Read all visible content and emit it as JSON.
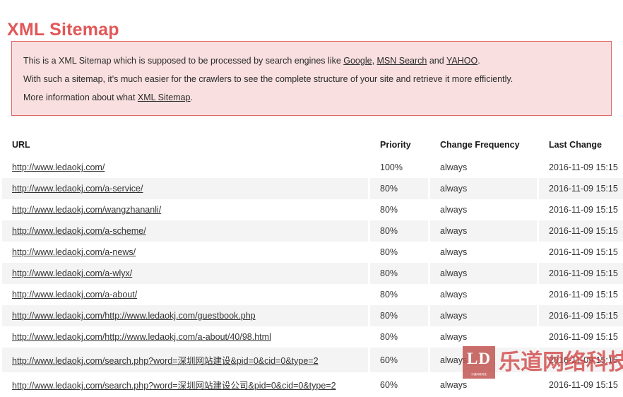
{
  "page": {
    "title": "XML Sitemap"
  },
  "info": {
    "line1_pre": "This is a XML Sitemap which is supposed to be processed by search engines like ",
    "link_google": "Google",
    "line1_sep1": ", ",
    "link_msn": "MSN Search",
    "line1_sep2": " and ",
    "link_yahoo": "YAHOO",
    "line1_end": ".",
    "line2": "With such a sitemap, it's much easier for the crawlers to see the complete structure of your site and retrieve it more efficiently.",
    "line3_pre": "More information about what ",
    "link_xml_sitemap": "XML Sitemap",
    "line3_end": "."
  },
  "table": {
    "headers": {
      "url": "URL",
      "priority": "Priority",
      "frequency": "Change Frequency",
      "lastchange": "Last Change"
    },
    "rows": [
      {
        "url": "http://www.ledaokj.com/",
        "priority": "100%",
        "frequency": "always",
        "lastchange": "2016-11-09 15:15"
      },
      {
        "url": "http://www.ledaokj.com/a-service/",
        "priority": "80%",
        "frequency": "always",
        "lastchange": "2016-11-09 15:15"
      },
      {
        "url": "http://www.ledaokj.com/wangzhananli/",
        "priority": "80%",
        "frequency": "always",
        "lastchange": "2016-11-09 15:15"
      },
      {
        "url": "http://www.ledaokj.com/a-scheme/",
        "priority": "80%",
        "frequency": "always",
        "lastchange": "2016-11-09 15:15"
      },
      {
        "url": "http://www.ledaokj.com/a-news/",
        "priority": "80%",
        "frequency": "always",
        "lastchange": "2016-11-09 15:15"
      },
      {
        "url": "http://www.ledaokj.com/a-wlyx/",
        "priority": "80%",
        "frequency": "always",
        "lastchange": "2016-11-09 15:15"
      },
      {
        "url": "http://www.ledaokj.com/a-about/",
        "priority": "80%",
        "frequency": "always",
        "lastchange": "2016-11-09 15:15"
      },
      {
        "url": "http://www.ledaokj.com/http://www.ledaokj.com/guestbook.php",
        "priority": "80%",
        "frequency": "always",
        "lastchange": "2016-11-09 15:15"
      },
      {
        "url": "http://www.ledaokj.com/http://www.ledaokj.com/a-about/40/98.html",
        "priority": "80%",
        "frequency": "always",
        "lastchange": "2016-11-09 15:15"
      },
      {
        "url": "http://www.ledaokj.com/search.php?word=深圳网站建设&pid=0&cid=0&type=2",
        "priority": "60%",
        "frequency": "always",
        "lastchange": "2016-11-09 15:15"
      },
      {
        "url": "http://www.ledaokj.com/search.php?word=深圳网站建设公司&pid=0&cid=0&type=2",
        "priority": "60%",
        "frequency": "always",
        "lastchange": "2016-11-09 15:15"
      }
    ]
  },
  "watermark": {
    "logo_letters": "LD",
    "logo_sub": "乐道网络科技",
    "text": "乐道网络科技"
  },
  "colors": {
    "title": "#e25757",
    "info_bg": "#f9dfdf",
    "info_border": "#dd6666",
    "row_alt_bg": "#f4f4f4",
    "watermark_red": "#d24b4b",
    "logo_bg": "#c0504d"
  }
}
